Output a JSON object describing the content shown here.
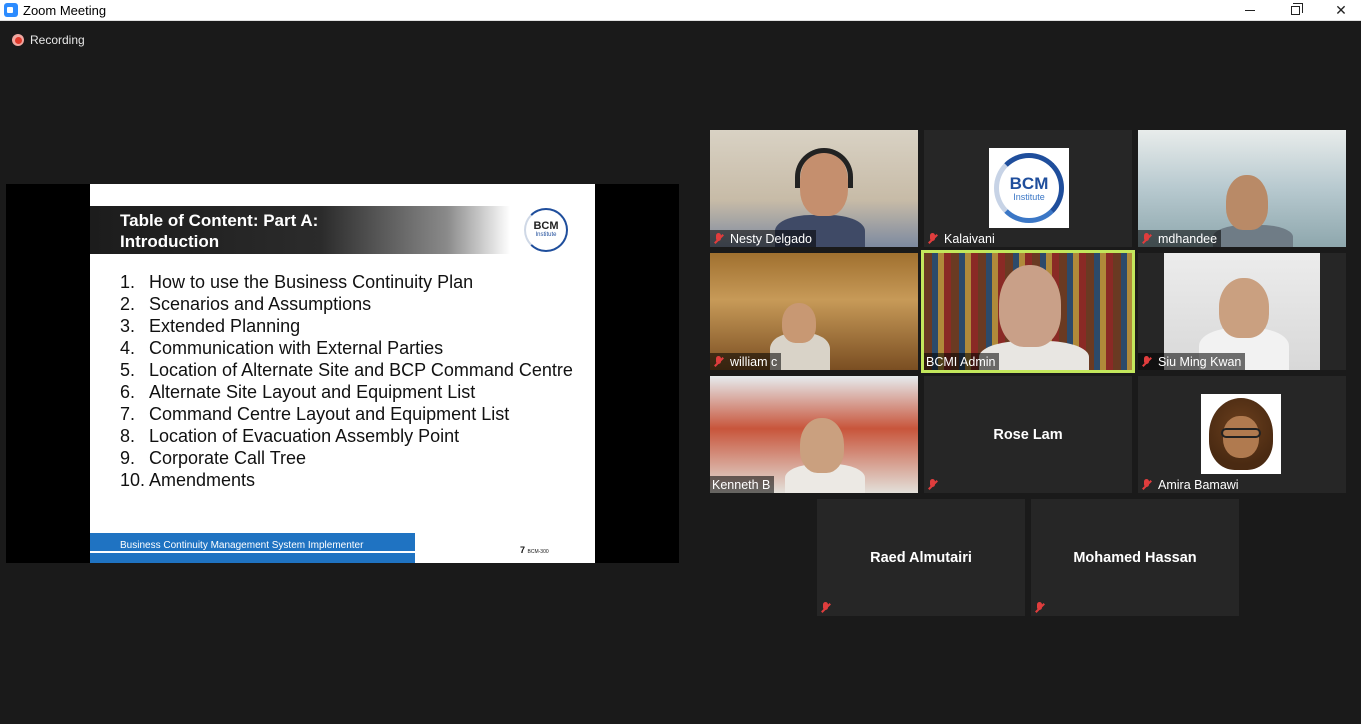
{
  "window": {
    "title": "Zoom Meeting"
  },
  "recording": {
    "label": "Recording"
  },
  "slide": {
    "title": "Table of Content: Part A:\nIntroduction",
    "logo": {
      "line1": "BCM",
      "line2": "Institute"
    },
    "items": [
      {
        "num": "1.",
        "text": "How to use the Business Continuity Plan"
      },
      {
        "num": "2.",
        "text": "Scenarios and Assumptions"
      },
      {
        "num": "3.",
        "text": "Extended Planning"
      },
      {
        "num": "4.",
        "text": "Communication with External Parties"
      },
      {
        "num": "5.",
        "text": "Location of Alternate Site and BCP Command Centre"
      },
      {
        "num": "6.",
        "text": "Alternate Site Layout and Equipment List"
      },
      {
        "num": "7.",
        "text": "Command Centre Layout and Equipment List"
      },
      {
        "num": "8.",
        "text": "Location of Evacuation Assembly Point"
      },
      {
        "num": "9.",
        "text": "Corporate Call Tree"
      },
      {
        "num": "10.",
        "text": "Amendments"
      }
    ],
    "footer": "Business Continuity Management System Implementer",
    "page": "7",
    "code": "BCM-300"
  },
  "participants": [
    {
      "name": "Nesty Delgado"
    },
    {
      "name": "Kalaivani",
      "logo_line1": "BCM",
      "logo_line2": "Institute"
    },
    {
      "name": "mdhandee"
    },
    {
      "name": "william c"
    },
    {
      "name": "BCMI Admin"
    },
    {
      "name": "Siu Ming Kwan"
    },
    {
      "name": "Kenneth B"
    },
    {
      "name": "Rose Lam"
    },
    {
      "name": "Amira Bamawi"
    },
    {
      "name": "Raed Almutairi"
    },
    {
      "name": "Mohamed Hassan"
    }
  ],
  "colors": {
    "active_speaker": "#c3e75c",
    "muted": "#e03d3d",
    "slide_footer": "#1f73c2"
  }
}
